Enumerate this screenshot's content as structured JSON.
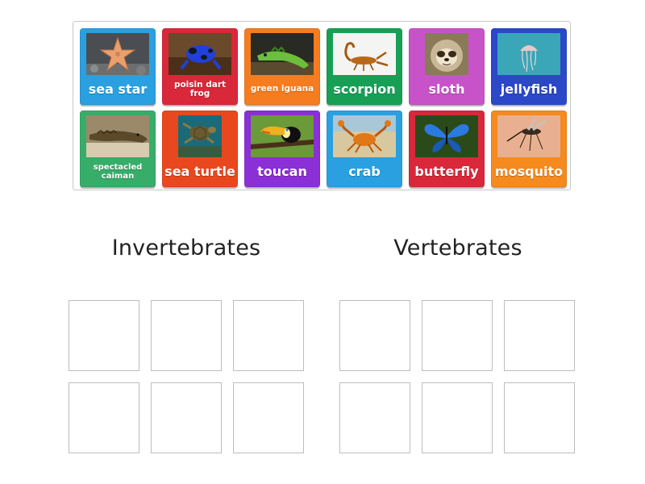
{
  "cards": [
    {
      "label": "sea star",
      "color": "#2aa0e0",
      "icon": "sea-star-photo"
    },
    {
      "label": "poisin dart frog",
      "color": "#d8283a",
      "icon": "poison-dart-frog-photo"
    },
    {
      "label": "green iguana",
      "color": "#f57d1f",
      "icon": "green-iguana-photo"
    },
    {
      "label": "scorpion",
      "color": "#17a055",
      "icon": "scorpion-photo"
    },
    {
      "label": "sloth",
      "color": "#c853c9",
      "icon": "sloth-photo"
    },
    {
      "label": "jellyfish",
      "color": "#2a48c8",
      "icon": "jellyfish-photo"
    },
    {
      "label": "spectacled caiman",
      "color": "#37ad6a",
      "icon": "caiman-photo"
    },
    {
      "label": "sea turtle",
      "color": "#e9481f",
      "icon": "sea-turtle-photo"
    },
    {
      "label": "toucan",
      "color": "#8b2fd6",
      "icon": "toucan-photo"
    },
    {
      "label": "crab",
      "color": "#2aa0e0",
      "icon": "crab-photo"
    },
    {
      "label": "butterfly",
      "color": "#d8283a",
      "icon": "butterfly-photo"
    },
    {
      "label": "mosquito",
      "color": "#f58a1f",
      "icon": "mosquito-photo"
    }
  ],
  "groups": [
    {
      "title": "Invertebrates"
    },
    {
      "title": "Vertebrates"
    }
  ]
}
